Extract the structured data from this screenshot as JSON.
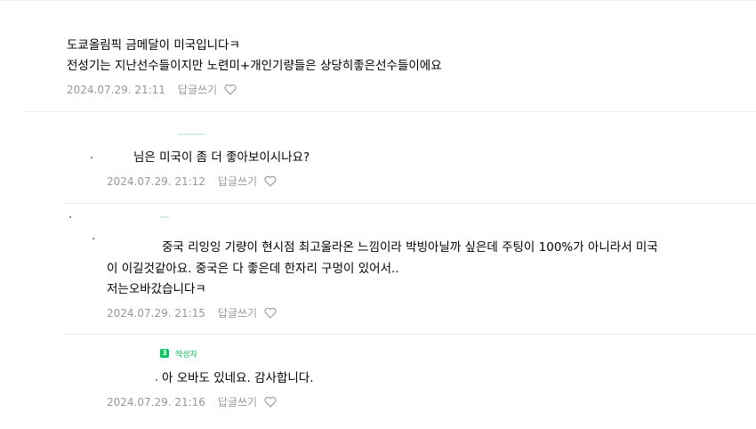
{
  "comments": [
    {
      "lines": [
        "도쿄올림픽 금메달이 미국입니다ㅋ",
        "전성기는 지난선수들이지만 노련미+개인기량들은 상당히좋은선수들이에요"
      ],
      "date": "2024.07.29. 21:11",
      "reply_label": "답글쓰기"
    },
    {
      "lines": [
        "님은 미국이 좀 더 좋아보이시나요?"
      ],
      "date": "2024.07.29. 21:12",
      "reply_label": "답글쓰기"
    },
    {
      "lines": [
        "중국 리잉잉 기량이 현시점 최고울라온 느낌이라 박빙아닐까 싶은데 주팅이 100%가 아니라서 미국",
        "이 이길것같아요. 중국은 다 좋은데 한자리 구멍이 있어서..",
        "저는오바갔습니다ㅋ"
      ],
      "date": "2024.07.29. 21:15",
      "reply_label": "답글쓰기"
    },
    {
      "author_badge": "3",
      "author_tag": "작성자",
      "lines": [
        "아 오바도 있네요. 감사합니다."
      ],
      "date": "2024.07.29. 21:16",
      "reply_label": "답글쓰기"
    }
  ],
  "icons": {
    "like": "heart-outline-icon"
  },
  "colors": {
    "meta": "#979797",
    "accent": "#03c75a",
    "divider": "#ececec"
  }
}
